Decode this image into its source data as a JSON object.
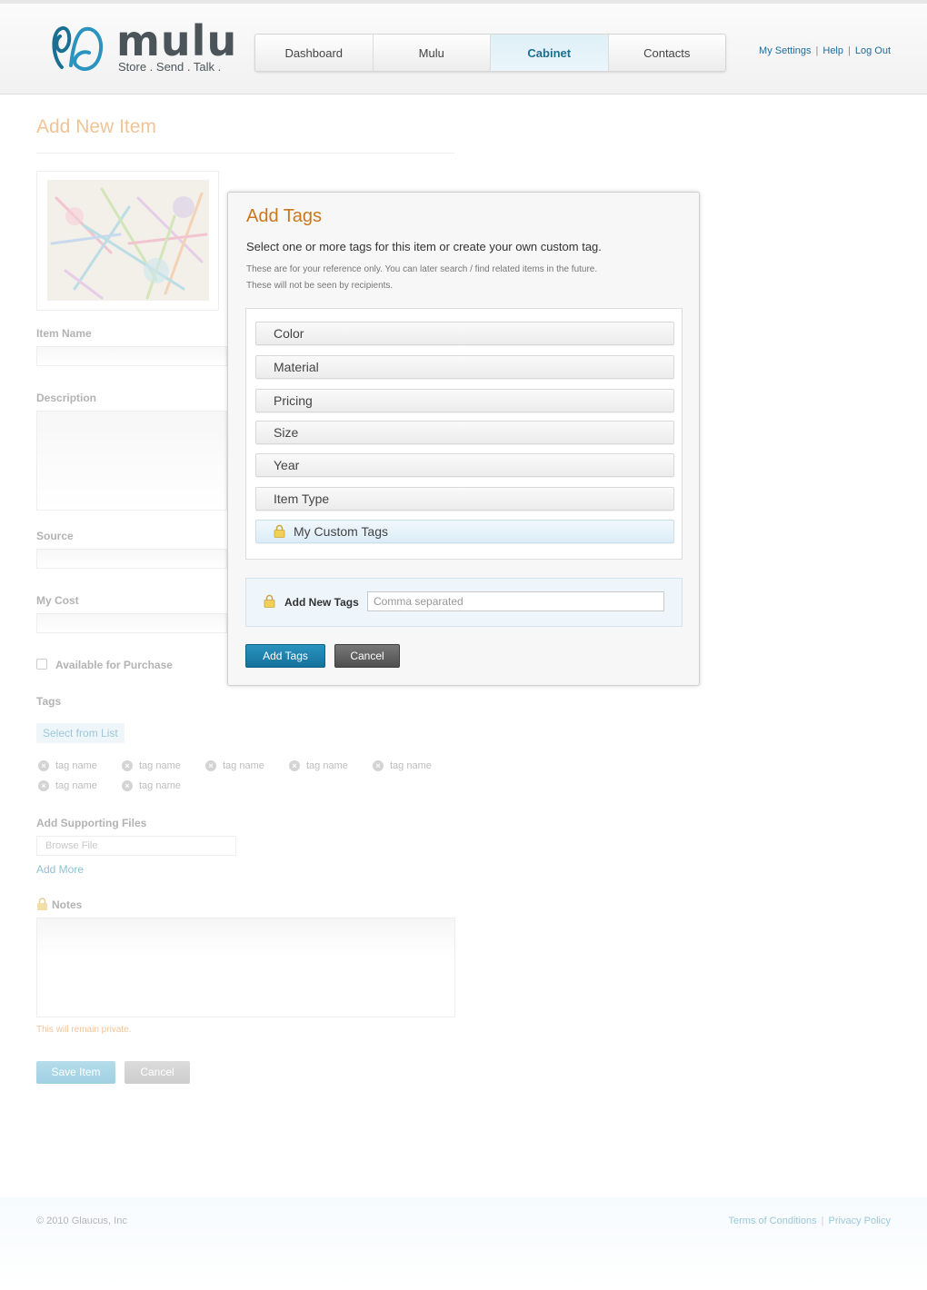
{
  "header": {
    "logo_word": "mulu",
    "logo_tagline": "Store . Send . Talk .",
    "nav_tabs": [
      {
        "label": "Dashboard",
        "active": false
      },
      {
        "label": "Mulu",
        "active": false
      },
      {
        "label": "Cabinet",
        "active": true
      },
      {
        "label": "Contacts",
        "active": false
      }
    ],
    "util_links": {
      "settings": "My Settings",
      "help": "Help",
      "logout": "Log Out"
    },
    "separator": "|"
  },
  "form": {
    "page_title": "Add New Item",
    "item_name_label": "Item Name",
    "description_label": "Description",
    "source_label": "Source",
    "cost_label": "My Cost",
    "available_label": "Available for Purchase",
    "tags_label": "Tags",
    "select_from_list": "Select from List",
    "tag_chips": [
      "tag name",
      "tag name",
      "tag name",
      "tag name",
      "tag name",
      "tag name",
      "tag name"
    ],
    "supporting_files_label": "Add Supporting Files",
    "browse_placeholder": "Browse File",
    "add_more": "Add More",
    "notes_label": "Notes",
    "private_note": "This will remain private.",
    "save_label": "Save Item",
    "cancel_label": "Cancel"
  },
  "modal": {
    "title": "Add Tags",
    "subtitle": "Select one or more tags for this item or create your own custom tag.",
    "note_line1": "These are for your reference only. You can later search / find related items in the future.",
    "note_line2": "These will not be seen by recipients.",
    "categories": [
      "Color",
      "Material",
      "Pricing",
      "Size",
      "Year",
      "Item Type"
    ],
    "custom_category": "My Custom Tags",
    "add_new_tags_label": "Add New Tags",
    "add_new_tags_placeholder": "Comma separated",
    "add_button": "Add Tags",
    "cancel_button": "Cancel"
  },
  "footer": {
    "copyright": "© 2010 Glaucus, Inc",
    "terms": "Terms of Conditions",
    "privacy": "Privacy Policy",
    "separator": "|"
  },
  "colors": {
    "accent_orange": "#c9781d",
    "brand_blue": "#1c6c9e",
    "primary_button": "#14729c"
  }
}
